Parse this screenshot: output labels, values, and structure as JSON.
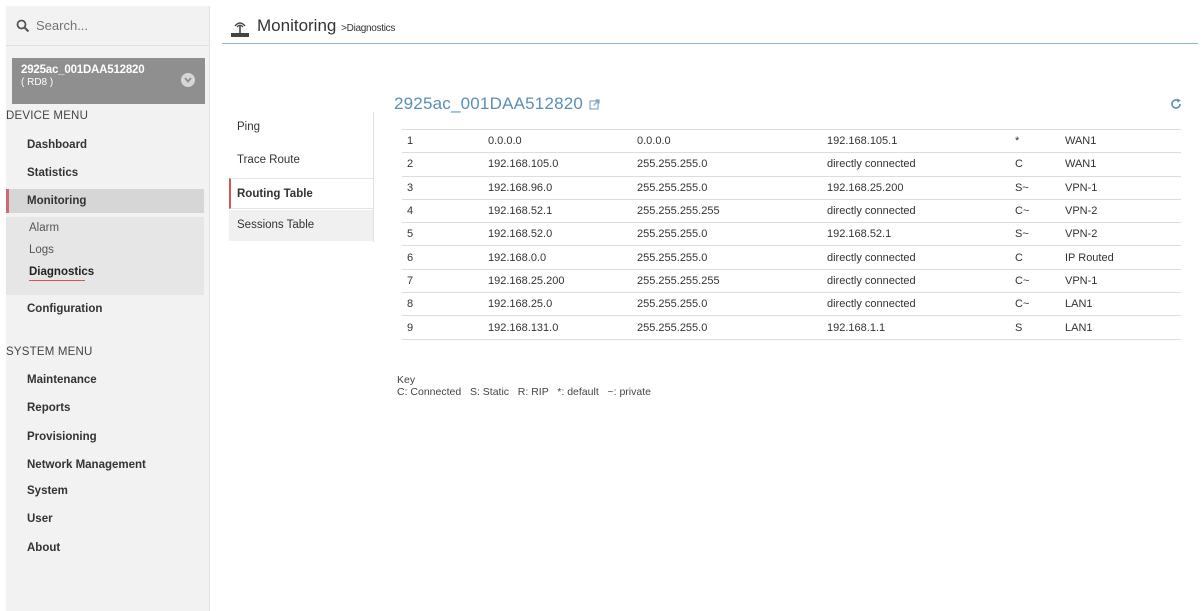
{
  "search": {
    "placeholder": "Search..."
  },
  "device": {
    "name": "2925ac_001DAA512820",
    "sub": "( RD8 )"
  },
  "device_menu": {
    "heading": "DEVICE MENU",
    "items": [
      "Dashboard",
      "Statistics",
      "Monitoring",
      "Configuration"
    ],
    "monitoring_sub": [
      "Alarm",
      "Logs",
      "Diagnostics"
    ]
  },
  "system_menu": {
    "heading": "SYSTEM MENU",
    "items": [
      "Maintenance",
      "Reports",
      "Provisioning",
      "Network Management",
      "System",
      "User",
      "About"
    ]
  },
  "header": {
    "title": "Monitoring",
    "breadcrumb": ">Diagnostics"
  },
  "tabs": [
    "Ping",
    "Trace Route",
    "Routing Table",
    "Sessions Table"
  ],
  "content": {
    "device_title": "2925ac_001DAA512820"
  },
  "routing_table": [
    [
      "1",
      "0.0.0.0",
      "0.0.0.0",
      "192.168.105.1",
      "*",
      "WAN1"
    ],
    [
      "2",
      "192.168.105.0",
      "255.255.255.0",
      "directly connected",
      "C",
      "WAN1"
    ],
    [
      "3",
      "192.168.96.0",
      "255.255.255.0",
      "192.168.25.200",
      "S~",
      "VPN-1"
    ],
    [
      "4",
      "192.168.52.1",
      "255.255.255.255",
      "directly connected",
      "C~",
      "VPN-2"
    ],
    [
      "5",
      "192.168.52.0",
      "255.255.255.0",
      "192.168.52.1",
      "S~",
      "VPN-2"
    ],
    [
      "6",
      "192.168.0.0",
      "255.255.255.0",
      "directly connected",
      "C",
      "IP Routed"
    ],
    [
      "7",
      "192.168.25.200",
      "255.255.255.255",
      "directly connected",
      "C~",
      "VPN-1"
    ],
    [
      "8",
      "192.168.25.0",
      "255.255.255.0",
      "directly connected",
      "C~",
      "LAN1"
    ],
    [
      "9",
      "192.168.131.0",
      "255.255.255.0",
      "192.168.1.1",
      "S",
      "LAN1"
    ]
  ],
  "key": {
    "title": "Key",
    "legend": "C: Connected   S: Static   R: RIP   *: default   ~: private"
  },
  "colors": {
    "accent": "#5a8fb5",
    "active_marker": "#c96b78",
    "device_box": "#8f8f8f"
  }
}
